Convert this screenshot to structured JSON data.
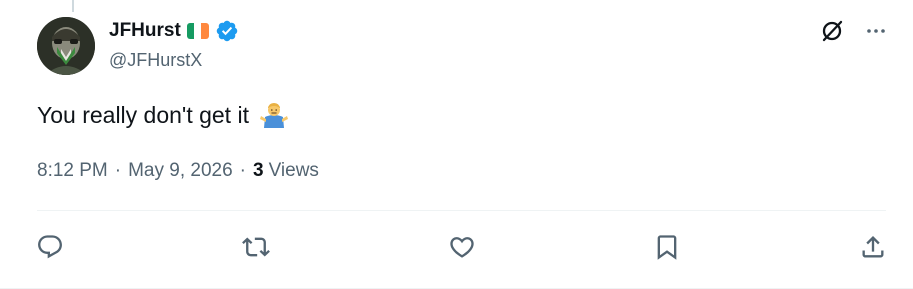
{
  "author": {
    "display_name": "JFHurst",
    "handle": "@JFHurstX",
    "flag": "ireland-flag-icon",
    "verified": true,
    "verified_color": "#1d9bf0"
  },
  "tweet": {
    "text": "You really don't get it",
    "emoji": "person-shrugging-icon",
    "time": "8:12 PM",
    "separator": "·",
    "date": "May 9, 2026",
    "views_count": "3",
    "views_label": "Views"
  },
  "icons": {
    "top_right": [
      "grok-icon",
      "more-icon"
    ],
    "actions": [
      "reply-icon",
      "retweet-icon",
      "like-icon",
      "bookmark-icon",
      "share-icon"
    ]
  },
  "colors": {
    "text_primary": "#0f1419",
    "text_secondary": "#536471",
    "icon": "#536471",
    "divider": "#eff3f4"
  }
}
